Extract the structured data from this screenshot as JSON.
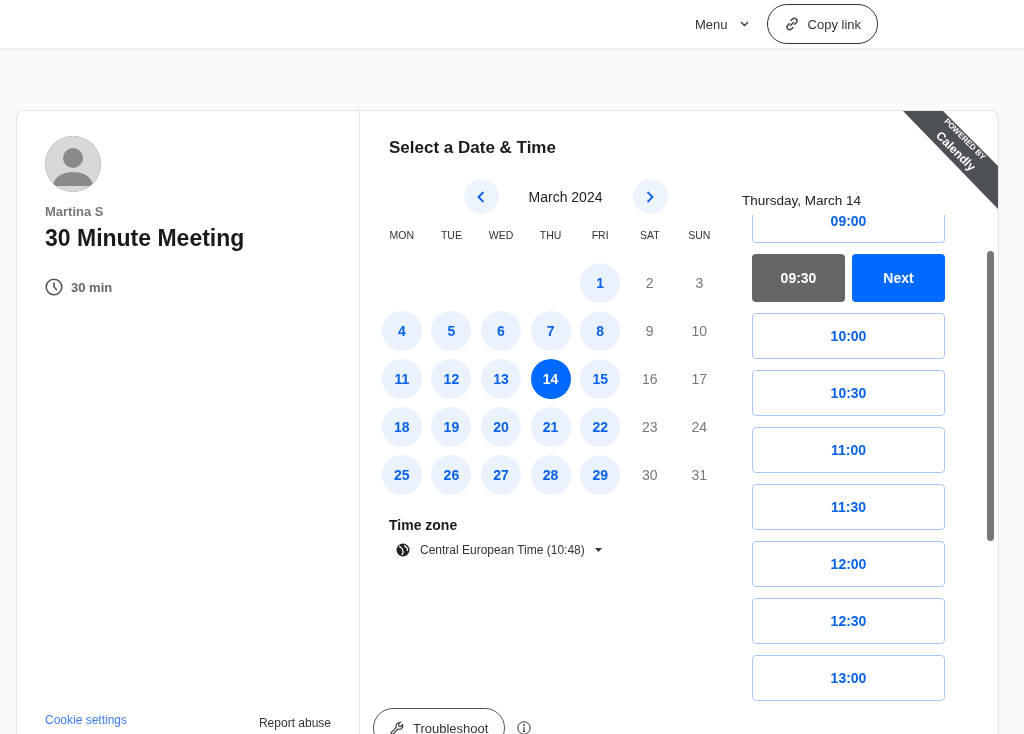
{
  "header": {
    "menu_label": "Menu",
    "copy_link_label": "Copy link"
  },
  "event": {
    "host": "Martina S",
    "title": "30 Minute Meeting",
    "duration": "30 min"
  },
  "footer": {
    "cookie_settings": "Cookie settings",
    "report_abuse": "Report abuse"
  },
  "ribbon": {
    "small": "POWERED BY",
    "brand": "Calendly"
  },
  "calendar": {
    "heading": "Select a Date & Time",
    "month": "March 2024",
    "weekdays": [
      "MON",
      "TUE",
      "WED",
      "THU",
      "FRI",
      "SAT",
      "SUN"
    ],
    "weeks": [
      [
        {
          "day": "1",
          "available": true,
          "selected": false
        },
        {
          "day": "2",
          "available": false,
          "selected": false
        },
        {
          "day": "3",
          "available": false,
          "selected": false
        }
      ],
      [
        {
          "day": "4",
          "available": true,
          "selected": false
        },
        {
          "day": "5",
          "available": true,
          "selected": false
        },
        {
          "day": "6",
          "available": true,
          "selected": false
        },
        {
          "day": "7",
          "available": true,
          "selected": false
        },
        {
          "day": "8",
          "available": true,
          "selected": false
        },
        {
          "day": "9",
          "available": false,
          "selected": false
        },
        {
          "day": "10",
          "available": false,
          "selected": false
        }
      ],
      [
        {
          "day": "11",
          "available": true,
          "selected": false
        },
        {
          "day": "12",
          "available": true,
          "selected": false
        },
        {
          "day": "13",
          "available": true,
          "selected": false
        },
        {
          "day": "14",
          "available": true,
          "selected": true
        },
        {
          "day": "15",
          "available": true,
          "selected": false
        },
        {
          "day": "16",
          "available": false,
          "selected": false
        },
        {
          "day": "17",
          "available": false,
          "selected": false
        }
      ],
      [
        {
          "day": "18",
          "available": true,
          "selected": false
        },
        {
          "day": "19",
          "available": true,
          "selected": false
        },
        {
          "day": "20",
          "available": true,
          "selected": false
        },
        {
          "day": "21",
          "available": true,
          "selected": false
        },
        {
          "day": "22",
          "available": true,
          "selected": false
        },
        {
          "day": "23",
          "available": false,
          "selected": false
        },
        {
          "day": "24",
          "available": false,
          "selected": false
        }
      ],
      [
        {
          "day": "25",
          "available": true,
          "selected": false
        },
        {
          "day": "26",
          "available": true,
          "selected": false
        },
        {
          "day": "27",
          "available": true,
          "selected": false
        },
        {
          "day": "28",
          "available": true,
          "selected": false
        },
        {
          "day": "29",
          "available": true,
          "selected": false
        },
        {
          "day": "30",
          "available": false,
          "selected": false
        },
        {
          "day": "31",
          "available": false,
          "selected": false
        }
      ]
    ],
    "timezone_label": "Time zone",
    "timezone": "Central European Time (10:48)",
    "troubleshoot_label": "Troubleshoot"
  },
  "times": {
    "date": "Thursday, March 14",
    "confirm_label": "Next",
    "slots": [
      {
        "time": "09:00",
        "selected": false
      },
      {
        "time": "09:30",
        "selected": true
      },
      {
        "time": "10:00",
        "selected": false
      },
      {
        "time": "10:30",
        "selected": false
      },
      {
        "time": "11:00",
        "selected": false
      },
      {
        "time": "11:30",
        "selected": false
      },
      {
        "time": "12:00",
        "selected": false
      },
      {
        "time": "12:30",
        "selected": false
      },
      {
        "time": "13:00",
        "selected": false
      }
    ]
  }
}
